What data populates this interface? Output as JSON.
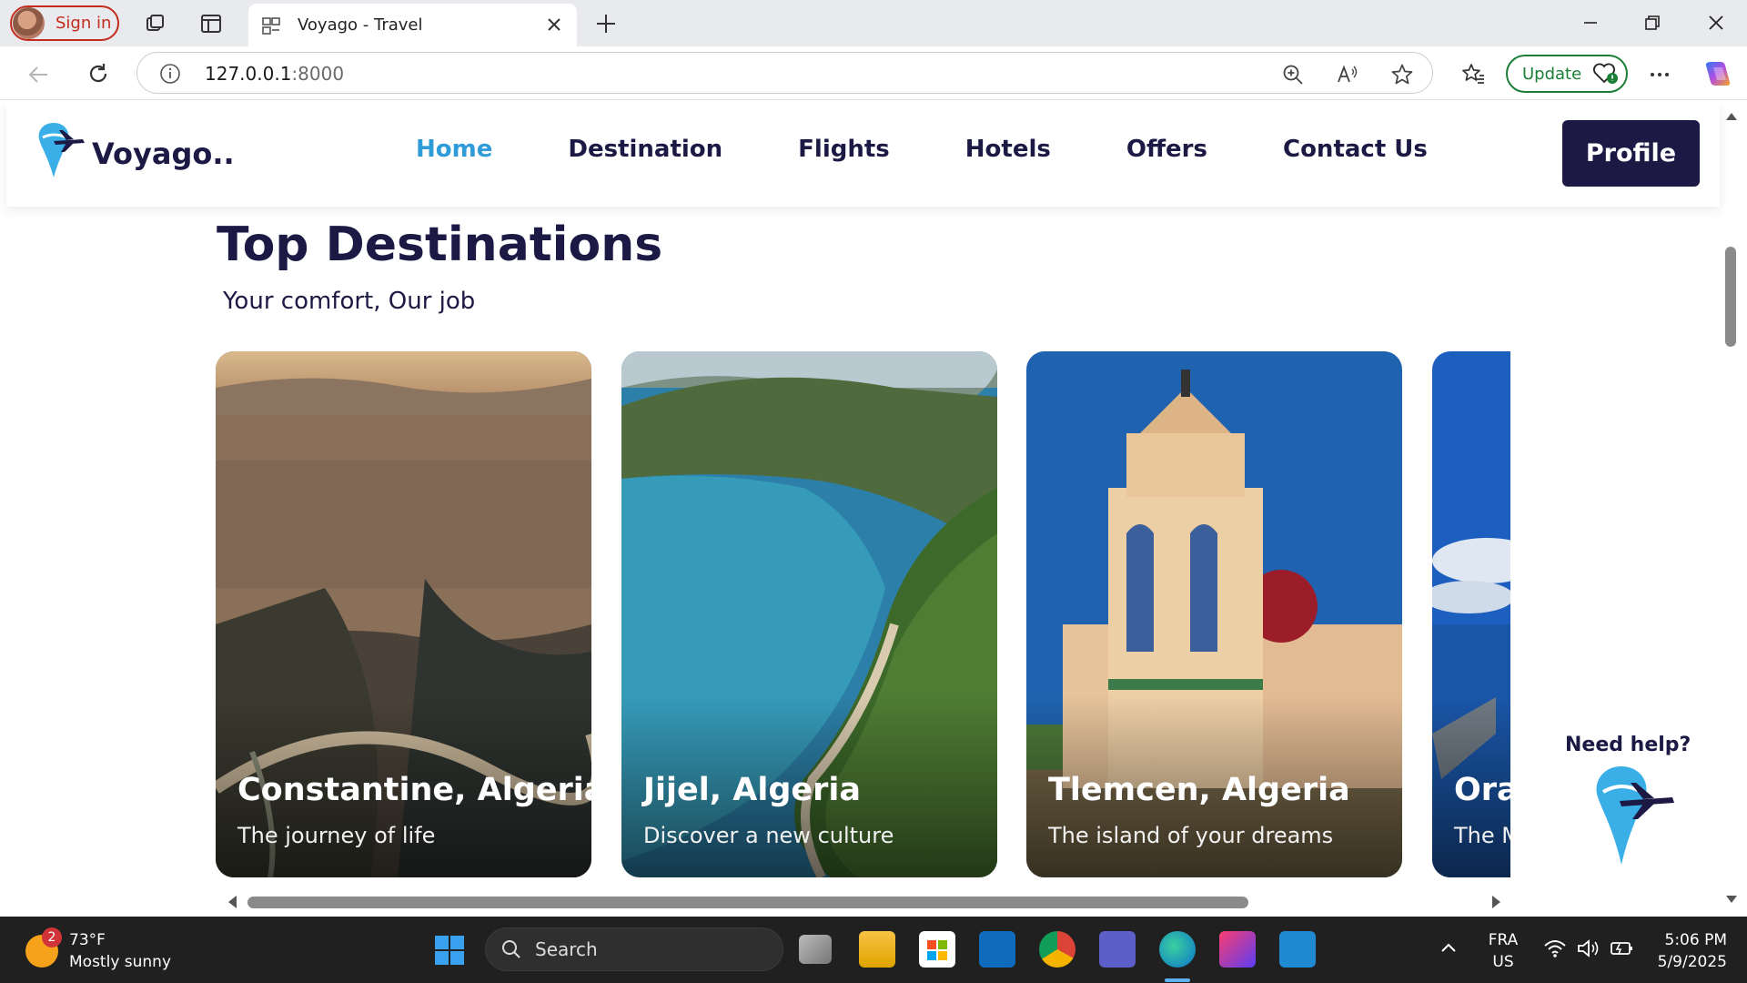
{
  "browser": {
    "signin_label": "Sign in",
    "tab_title": "Voyago - Travel",
    "url_host": "127.0.0.1",
    "url_port": ":8000",
    "update_label": "Update"
  },
  "site": {
    "logo_text": "Voyago..",
    "nav": [
      {
        "label": "Home",
        "active": true
      },
      {
        "label": "Destination",
        "active": false
      },
      {
        "label": "Flights",
        "active": false
      },
      {
        "label": "Hotels",
        "active": false
      },
      {
        "label": "Offers",
        "active": false
      },
      {
        "label": "Contact Us",
        "active": false
      }
    ],
    "profile_label": "Profile",
    "colors": {
      "brand": "#1c1a45",
      "accent": "#2f9bd8"
    }
  },
  "section": {
    "title": "Top Destinations",
    "subtitle": "Your comfort, Our job"
  },
  "destinations": [
    {
      "title": "Constantine, Algeria",
      "subtitle": "The journey of life"
    },
    {
      "title": "Jijel, Algeria",
      "subtitle": "Discover a new culture"
    },
    {
      "title": "Tlemcen, Algeria",
      "subtitle": "The island of your dreams"
    },
    {
      "title": "Ora",
      "subtitle": "The M"
    }
  ],
  "help": {
    "label": "Need help?"
  },
  "taskbar": {
    "weather_badge": "2",
    "temperature": "73°F",
    "condition": "Mostly sunny",
    "search_label": "Search",
    "lang_top": "FRA",
    "lang_bottom": "US",
    "time": "5:06 PM",
    "date": "5/9/2025"
  }
}
